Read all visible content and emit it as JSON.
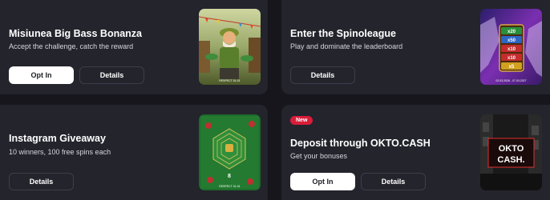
{
  "promos": [
    {
      "title": "Misiunea Big Bass Bonanza",
      "subtitle": "Accept the challenge, catch the reward",
      "primary_label": "Opt In",
      "secondary_label": "Details",
      "thumb_caption": "RESPECT 01-01"
    },
    {
      "title": "Enter the Spinoleague",
      "subtitle": "Play and dominate the leaderboard",
      "secondary_label": "Details",
      "thumb_caption": "02.03.2026 - 07.03.2027",
      "thumb_multipliers": [
        "x20",
        "x50",
        "x10",
        "x10",
        "x5"
      ]
    },
    {
      "title": "Instagram Giveaway",
      "subtitle": "10 winners, 100 free spins each",
      "secondary_label": "Details",
      "thumb_caption": "8",
      "thumb_footer": "RESPECT 01-01"
    },
    {
      "badge": "New",
      "title": "Deposit through OKTO.CASH",
      "subtitle": "Get your bonuses",
      "primary_label": "Opt In",
      "secondary_label": "Details",
      "thumb_text_line1": "OKTO",
      "thumb_text_line2": "CASH."
    }
  ],
  "colors": {
    "page_bg": "#16161c",
    "card_bg": "#24242d",
    "badge": "#d81d3a"
  }
}
